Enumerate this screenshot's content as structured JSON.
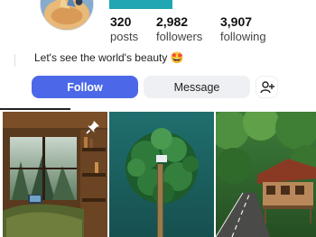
{
  "profile": {
    "stats": [
      {
        "value": "320",
        "label": "posts"
      },
      {
        "value": "2,982",
        "label": "followers"
      },
      {
        "value": "3,907",
        "label": "following"
      }
    ],
    "bio": "Let's see the world's beauty 🤩"
  },
  "actions": {
    "follow_label": "Follow",
    "message_label": "Message",
    "add_icon": "add-person-icon"
  },
  "colors": {
    "follow_button": "#4c68e8",
    "message_button": "#eef0f3",
    "accent_strip": "#22a6b3"
  },
  "grid": {
    "pinned_icon": "pin-icon",
    "posts": [
      {
        "icon": "cabin-window-photo"
      },
      {
        "icon": "island-aerial-photo"
      },
      {
        "icon": "forest-road-photo"
      }
    ]
  }
}
